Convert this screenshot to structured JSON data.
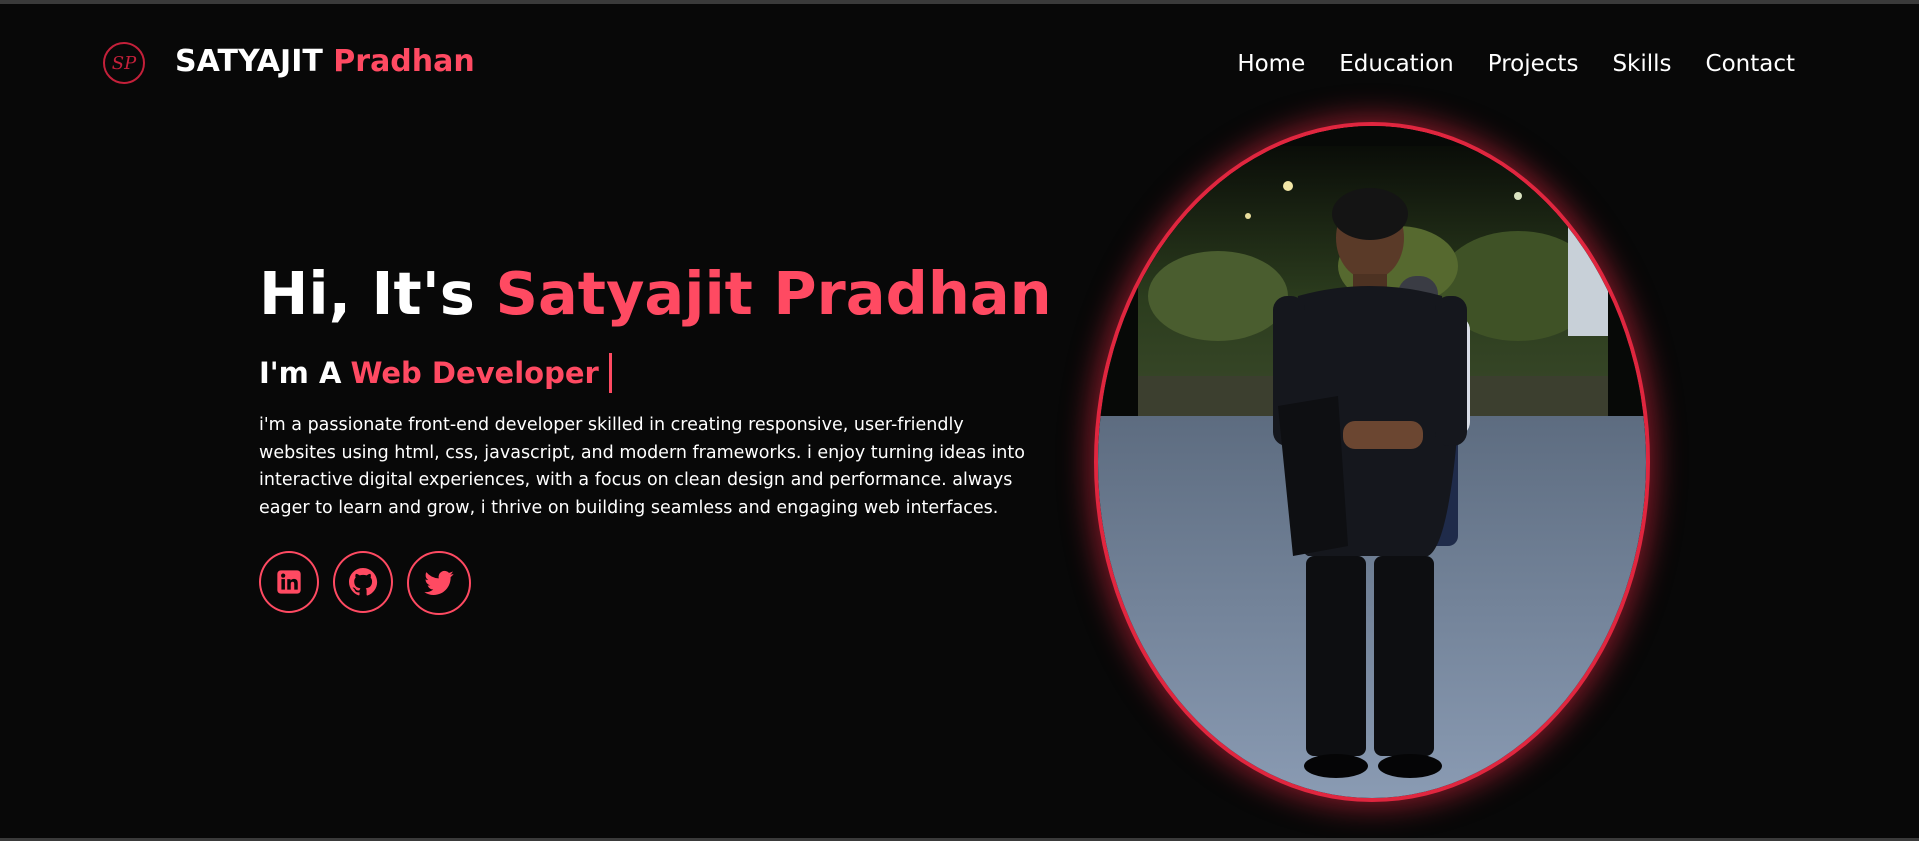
{
  "brand": {
    "first": "SATYAJIT",
    "last": "Pradhan",
    "logo_text": "SP"
  },
  "nav": {
    "items": [
      "Home",
      "Education",
      "Projects",
      "Skills",
      "Contact"
    ]
  },
  "hero": {
    "greeting": "Hi, It's",
    "name": "Satyajit Pradhan",
    "role_prefix": "I'm A",
    "role": "Web Developer",
    "description": "i'm a passionate front-end developer skilled in creating responsive, user-friendly websites using html, css, javascript, and modern frameworks. i enjoy turning ideas into interactive digital experiences, with a focus on clean design and performance. always eager to learn and grow, i thrive on building seamless and engaging web interfaces."
  },
  "socials": [
    {
      "icon": "linkedin-icon"
    },
    {
      "icon": "github-icon"
    },
    {
      "icon": "twitter-icon"
    }
  ],
  "colors": {
    "background": "#080808",
    "accent": "#ff4a62",
    "glow": "#e0263f",
    "text": "#ffffff"
  }
}
